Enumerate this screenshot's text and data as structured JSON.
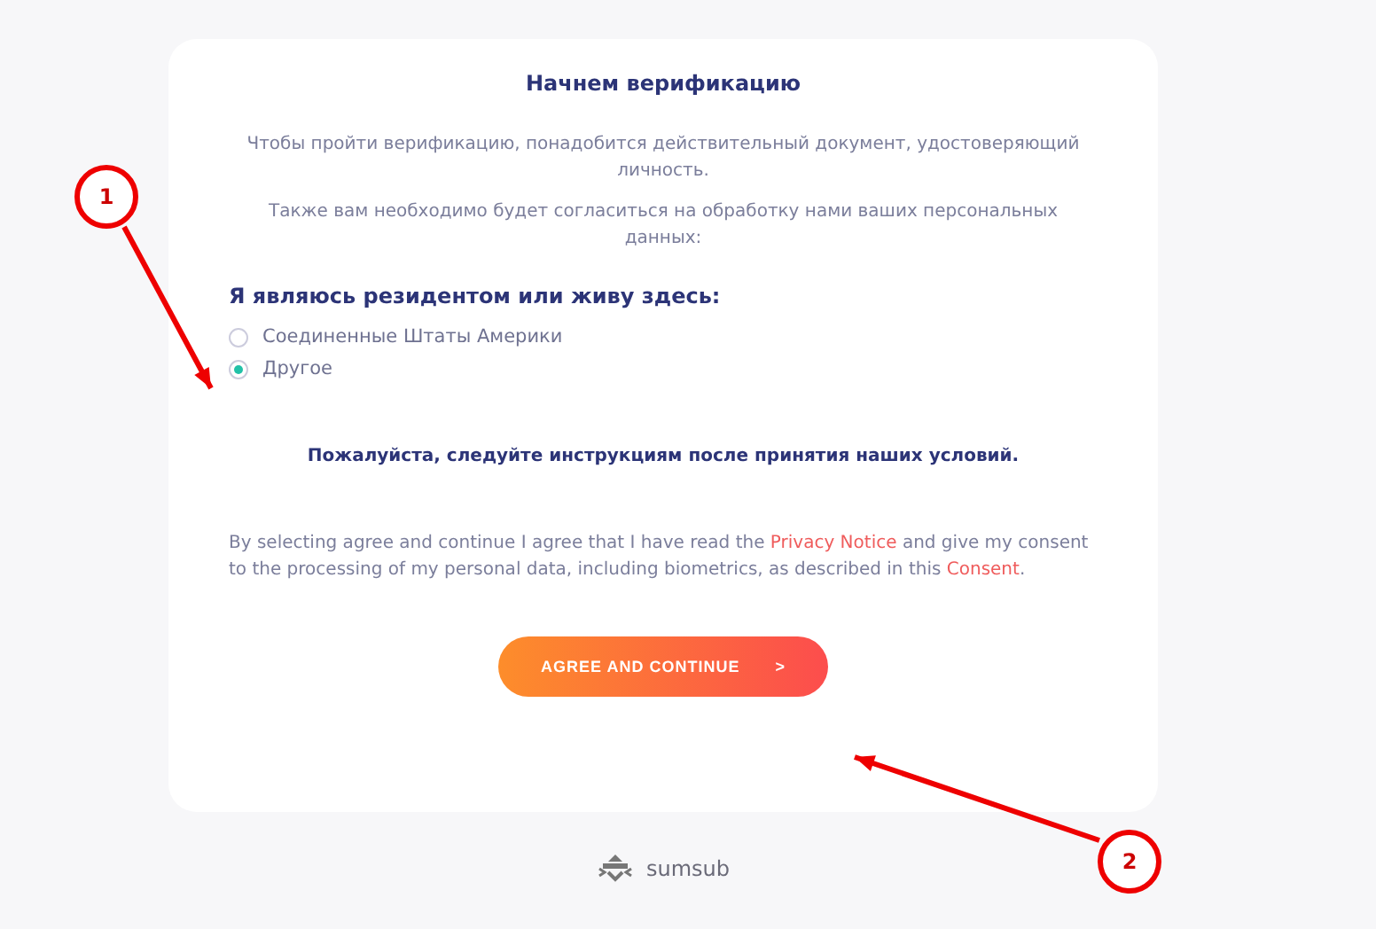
{
  "card": {
    "title": "Начнем верификацию",
    "paragraphs": [
      "Чтобы пройти верификацию, понадобится действительный документ, удостоверяющий личность.",
      "Также вам необходимо будет согласиться на обработку нами ваших персональных данных:"
    ],
    "residence": {
      "label": "Я являюсь резидентом или живу здесь:",
      "options": [
        {
          "label": "Соединенные Штаты Америки",
          "selected": false
        },
        {
          "label": "Другое",
          "selected": true
        }
      ]
    },
    "instruction": "Пожалуйста, следуйте инструкциям после принятия наших условий.",
    "consent": [
      {
        "kind": "text",
        "text": "By selecting agree and continue I agree that I have read the "
      },
      {
        "kind": "link",
        "text": "Privacy Notice"
      },
      {
        "kind": "text",
        "text": " and give my consent to the processing of my personal data, including biometrics, as described in this "
      },
      {
        "kind": "link",
        "text": "Consent"
      },
      {
        "kind": "text",
        "text": "."
      }
    ],
    "button": {
      "label": "AGREE AND CONTINUE",
      "arrow": ">"
    }
  },
  "footer": {
    "brand": "sumsub"
  },
  "annotations": [
    {
      "number": "1"
    },
    {
      "number": "2"
    }
  ]
}
